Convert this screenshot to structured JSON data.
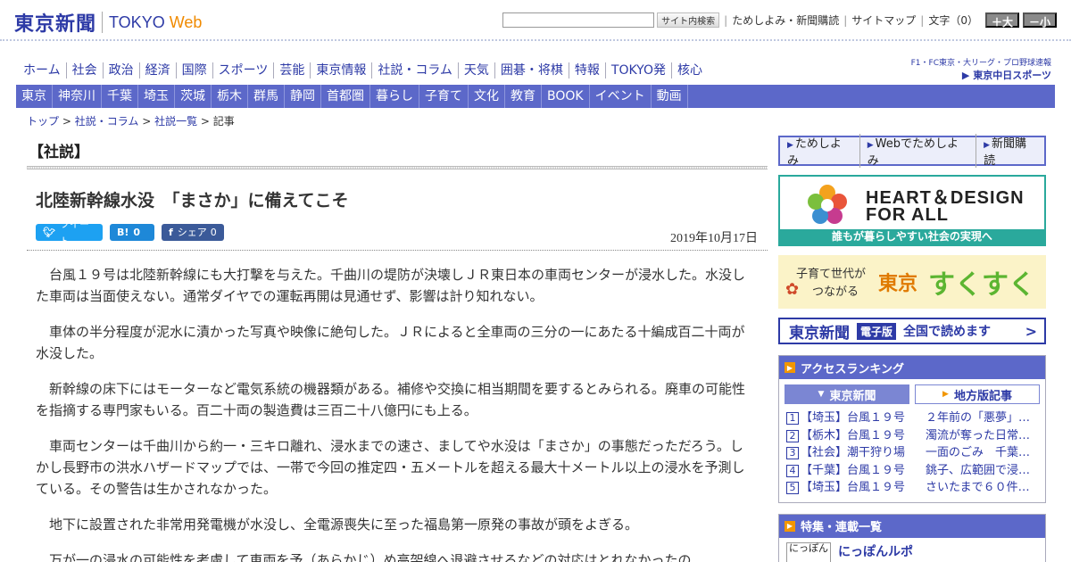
{
  "site": {
    "logo_ja": "東京新聞",
    "logo_en": "TOKYO",
    "logo_web": "Web"
  },
  "tools": {
    "search_placeholder": "",
    "search_button": "サイト内検索",
    "trial_link": "ためしよみ・新聞購読",
    "sitemap_link": "サイトマップ",
    "font_size_label": "文字（0）",
    "font_larger": "＋大",
    "font_smaller": "－小"
  },
  "main_nav": [
    "ホーム",
    "社会",
    "政治",
    "経済",
    "国際",
    "スポーツ",
    "芸能",
    "東京情報",
    "社説・コラム",
    "天気",
    "囲碁・将棋",
    "特報",
    "TOKYO発",
    "核心"
  ],
  "chunichi": {
    "line1": "F1・FC東京・大リーグ・プロ野球速報",
    "line2": "▶ 東京中日スポーツ"
  },
  "sub_nav": [
    "東京",
    "神奈川",
    "千葉",
    "埼玉",
    "茨城",
    "栃木",
    "群馬",
    "静岡",
    "首都圏",
    "暮らし",
    "子育て",
    "文化",
    "教育",
    "BOOK",
    "イベント",
    "動画"
  ],
  "breadcrumb": [
    "トップ",
    "社説・コラム",
    "社説一覧",
    "記事"
  ],
  "article": {
    "section_label": "【社説】",
    "headline": "北陸新幹線水没　「まさか」に備えてこそ",
    "date": "2019年10月17日",
    "share": {
      "tweet": "ツイート",
      "hatena_count": "0",
      "facebook": "シェア",
      "facebook_count": "0"
    },
    "paragraphs": [
      "台風１９号は北陸新幹線にも大打撃を与えた。千曲川の堤防が決壊しＪＲ東日本の車両センターが浸水した。水没した車両は当面使えない。通常ダイヤでの運転再開は見通せず、影響は計り知れない。",
      "車体の半分程度が泥水に漬かった写真や映像に絶句した。ＪＲによると全車両の三分の一にあたる十編成百二十両が水没した。",
      "新幹線の床下にはモーターなど電気系統の機器類がある。補修や交換に相当期間を要するとみられる。廃車の可能性を指摘する専門家もいる。百二十両の製造費は三百二十八億円にも上る。",
      "車両センターは千曲川から約一・三キロ離れ、浸水までの速さ、ましてや水没は「まさか」の事態だっただろう。しかし長野市の洪水ハザードマップでは、一帯で今回の推定四・五メートルを超える最大十メートル以上の浸水を予測している。その警告は生かされなかった。",
      "地下に設置された非常用発電機が水没し、全電源喪失に至った福島第一原発の事故が頭をよぎる。",
      "万が一の浸水の可能性を考慮して車両を予（あらかじ）め高架線へ退避させるなどの対応はとれなかったの"
    ]
  },
  "sidebar": {
    "read_box": [
      "ためしよみ",
      "Webでためしよみ",
      "新聞購読"
    ],
    "heart": {
      "line1": "HEART＆DESIGN",
      "line2": "FOR ALL",
      "bar": "誰もが暮らしやすい社会の実現へ"
    },
    "sukusuku": {
      "a": "子育て世代が",
      "b": "つながる",
      "c": "東京",
      "d": "すくすく"
    },
    "ebook": {
      "logo": "東京新聞",
      "badge": "電子版",
      "text": "全国で読めます"
    },
    "ranking": {
      "title": "アクセスランキング",
      "tab_active": "東京新聞",
      "tab_inactive": "地方版記事",
      "items": [
        {
          "num": "1",
          "tag": "【埼玉】台風１９号",
          "title": "２年前の「悪夢」再…"
        },
        {
          "num": "2",
          "tag": "【栃木】台風１９号",
          "title": "濁流が奪った日常　…"
        },
        {
          "num": "3",
          "tag": "【社会】潮干狩り場",
          "title": "一面のごみ　千葉・…"
        },
        {
          "num": "4",
          "tag": "【千葉】台風１９号",
          "title": "銚子、広範囲で浸水…"
        },
        {
          "num": "5",
          "tag": "【埼玉】台風１９号",
          "title": "さいたまで６０件浸…"
        }
      ]
    },
    "feature": {
      "title": "特集・連載一覧",
      "item_thumb": "にっぽん",
      "item_title": "にっぽんルポ"
    }
  },
  "colors": {
    "brand_blue": "#2d3aa6",
    "nav_bar": "#5c68c9",
    "accent_orange": "#f29600",
    "teal": "#2aa99c"
  }
}
